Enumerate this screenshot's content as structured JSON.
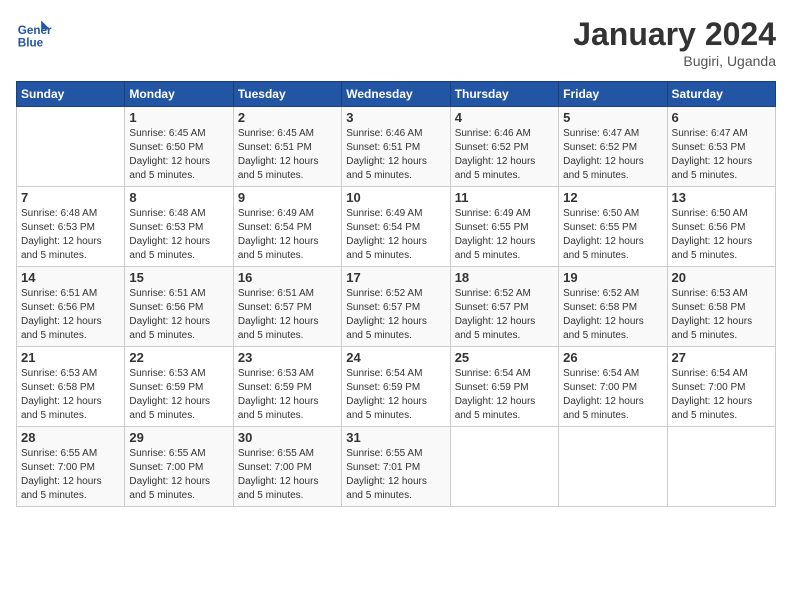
{
  "logo": {
    "line1": "General",
    "line2": "Blue"
  },
  "title": "January 2024",
  "location": "Bugiri, Uganda",
  "days_of_week": [
    "Sunday",
    "Monday",
    "Tuesday",
    "Wednesday",
    "Thursday",
    "Friday",
    "Saturday"
  ],
  "weeks": [
    [
      {
        "day": "",
        "info": ""
      },
      {
        "day": "1",
        "info": "Sunrise: 6:45 AM\nSunset: 6:50 PM\nDaylight: 12 hours\nand 5 minutes."
      },
      {
        "day": "2",
        "info": "Sunrise: 6:45 AM\nSunset: 6:51 PM\nDaylight: 12 hours\nand 5 minutes."
      },
      {
        "day": "3",
        "info": "Sunrise: 6:46 AM\nSunset: 6:51 PM\nDaylight: 12 hours\nand 5 minutes."
      },
      {
        "day": "4",
        "info": "Sunrise: 6:46 AM\nSunset: 6:52 PM\nDaylight: 12 hours\nand 5 minutes."
      },
      {
        "day": "5",
        "info": "Sunrise: 6:47 AM\nSunset: 6:52 PM\nDaylight: 12 hours\nand 5 minutes."
      },
      {
        "day": "6",
        "info": "Sunrise: 6:47 AM\nSunset: 6:53 PM\nDaylight: 12 hours\nand 5 minutes."
      }
    ],
    [
      {
        "day": "7",
        "info": "Sunrise: 6:48 AM\nSunset: 6:53 PM\nDaylight: 12 hours\nand 5 minutes."
      },
      {
        "day": "8",
        "info": "Sunrise: 6:48 AM\nSunset: 6:53 PM\nDaylight: 12 hours\nand 5 minutes."
      },
      {
        "day": "9",
        "info": "Sunrise: 6:49 AM\nSunset: 6:54 PM\nDaylight: 12 hours\nand 5 minutes."
      },
      {
        "day": "10",
        "info": "Sunrise: 6:49 AM\nSunset: 6:54 PM\nDaylight: 12 hours\nand 5 minutes."
      },
      {
        "day": "11",
        "info": "Sunrise: 6:49 AM\nSunset: 6:55 PM\nDaylight: 12 hours\nand 5 minutes."
      },
      {
        "day": "12",
        "info": "Sunrise: 6:50 AM\nSunset: 6:55 PM\nDaylight: 12 hours\nand 5 minutes."
      },
      {
        "day": "13",
        "info": "Sunrise: 6:50 AM\nSunset: 6:56 PM\nDaylight: 12 hours\nand 5 minutes."
      }
    ],
    [
      {
        "day": "14",
        "info": "Sunrise: 6:51 AM\nSunset: 6:56 PM\nDaylight: 12 hours\nand 5 minutes."
      },
      {
        "day": "15",
        "info": "Sunrise: 6:51 AM\nSunset: 6:56 PM\nDaylight: 12 hours\nand 5 minutes."
      },
      {
        "day": "16",
        "info": "Sunrise: 6:51 AM\nSunset: 6:57 PM\nDaylight: 12 hours\nand 5 minutes."
      },
      {
        "day": "17",
        "info": "Sunrise: 6:52 AM\nSunset: 6:57 PM\nDaylight: 12 hours\nand 5 minutes."
      },
      {
        "day": "18",
        "info": "Sunrise: 6:52 AM\nSunset: 6:57 PM\nDaylight: 12 hours\nand 5 minutes."
      },
      {
        "day": "19",
        "info": "Sunrise: 6:52 AM\nSunset: 6:58 PM\nDaylight: 12 hours\nand 5 minutes."
      },
      {
        "day": "20",
        "info": "Sunrise: 6:53 AM\nSunset: 6:58 PM\nDaylight: 12 hours\nand 5 minutes."
      }
    ],
    [
      {
        "day": "21",
        "info": "Sunrise: 6:53 AM\nSunset: 6:58 PM\nDaylight: 12 hours\nand 5 minutes."
      },
      {
        "day": "22",
        "info": "Sunrise: 6:53 AM\nSunset: 6:59 PM\nDaylight: 12 hours\nand 5 minutes."
      },
      {
        "day": "23",
        "info": "Sunrise: 6:53 AM\nSunset: 6:59 PM\nDaylight: 12 hours\nand 5 minutes."
      },
      {
        "day": "24",
        "info": "Sunrise: 6:54 AM\nSunset: 6:59 PM\nDaylight: 12 hours\nand 5 minutes."
      },
      {
        "day": "25",
        "info": "Sunrise: 6:54 AM\nSunset: 6:59 PM\nDaylight: 12 hours\nand 5 minutes."
      },
      {
        "day": "26",
        "info": "Sunrise: 6:54 AM\nSunset: 7:00 PM\nDaylight: 12 hours\nand 5 minutes."
      },
      {
        "day": "27",
        "info": "Sunrise: 6:54 AM\nSunset: 7:00 PM\nDaylight: 12 hours\nand 5 minutes."
      }
    ],
    [
      {
        "day": "28",
        "info": "Sunrise: 6:55 AM\nSunset: 7:00 PM\nDaylight: 12 hours\nand 5 minutes."
      },
      {
        "day": "29",
        "info": "Sunrise: 6:55 AM\nSunset: 7:00 PM\nDaylight: 12 hours\nand 5 minutes."
      },
      {
        "day": "30",
        "info": "Sunrise: 6:55 AM\nSunset: 7:00 PM\nDaylight: 12 hours\nand 5 minutes."
      },
      {
        "day": "31",
        "info": "Sunrise: 6:55 AM\nSunset: 7:01 PM\nDaylight: 12 hours\nand 5 minutes."
      },
      {
        "day": "",
        "info": ""
      },
      {
        "day": "",
        "info": ""
      },
      {
        "day": "",
        "info": ""
      }
    ]
  ]
}
